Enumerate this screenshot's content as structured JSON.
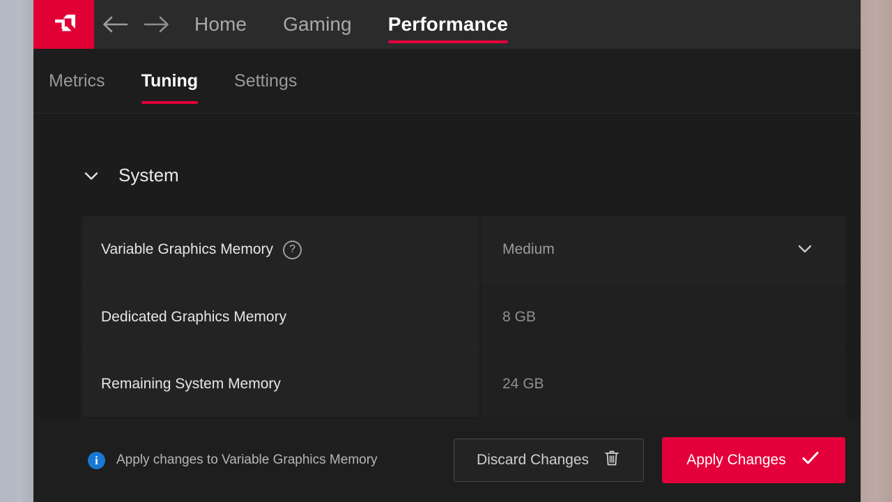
{
  "app": {
    "logo_icon": "amd-logo-icon",
    "back_icon": "arrow-left-icon",
    "forward_icon": "arrow-right-icon"
  },
  "top_nav": {
    "items": [
      {
        "label": "Home",
        "active": false
      },
      {
        "label": "Gaming",
        "active": false
      },
      {
        "label": "Performance",
        "active": true
      }
    ]
  },
  "sub_nav": {
    "items": [
      {
        "label": "Metrics",
        "active": false
      },
      {
        "label": "Tuning",
        "active": true
      },
      {
        "label": "Settings",
        "active": false
      }
    ]
  },
  "section": {
    "title": "System",
    "collapse_icon": "chevron-down-icon",
    "expanded": true
  },
  "rows": [
    {
      "label": "Variable Graphics Memory",
      "value": "Medium",
      "type": "select",
      "help_icon": "question-mark-icon",
      "help_glyph": "?",
      "chevron_icon": "chevron-down-icon"
    },
    {
      "label": "Dedicated Graphics Memory",
      "value": "8 GB",
      "type": "readonly"
    },
    {
      "label": "Remaining System Memory",
      "value": "24 GB",
      "type": "readonly"
    }
  ],
  "action_bar": {
    "info_icon": "info-circle-icon",
    "info_glyph": "i",
    "notice": "Apply changes to Variable Graphics Memory",
    "discard_label": "Discard Changes",
    "discard_icon": "trash-icon",
    "apply_label": "Apply Changes",
    "apply_icon": "checkmark-icon"
  },
  "colors": {
    "brand_red": "#e4003a",
    "info_blue": "#1878d4",
    "window_bg": "#1c1c1c",
    "row_bg": "#232323",
    "topbar_bg": "#2b2b2b"
  }
}
